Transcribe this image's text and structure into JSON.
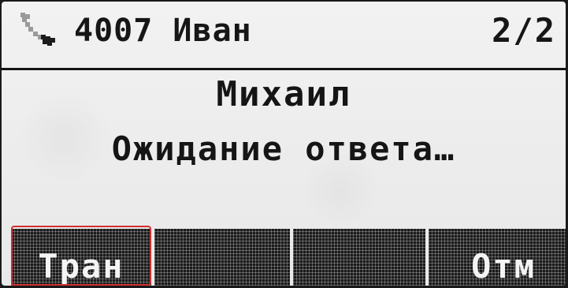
{
  "status_bar": {
    "line_icon": "handset-icon",
    "line_label": "4007 Иван",
    "call_counter": "2/2"
  },
  "call": {
    "callee_name": "Михаил",
    "status": "Ожидание ответа…"
  },
  "softkeys": [
    {
      "label": "Тран",
      "highlighted": true
    },
    {
      "label": ""
    },
    {
      "label": ""
    },
    {
      "label": "Отм"
    }
  ],
  "colors": {
    "screen_bg": "#f0f0f0",
    "text": "#151515",
    "softkey_bg": "#1a1a1a",
    "highlight": "#d32f2f"
  }
}
